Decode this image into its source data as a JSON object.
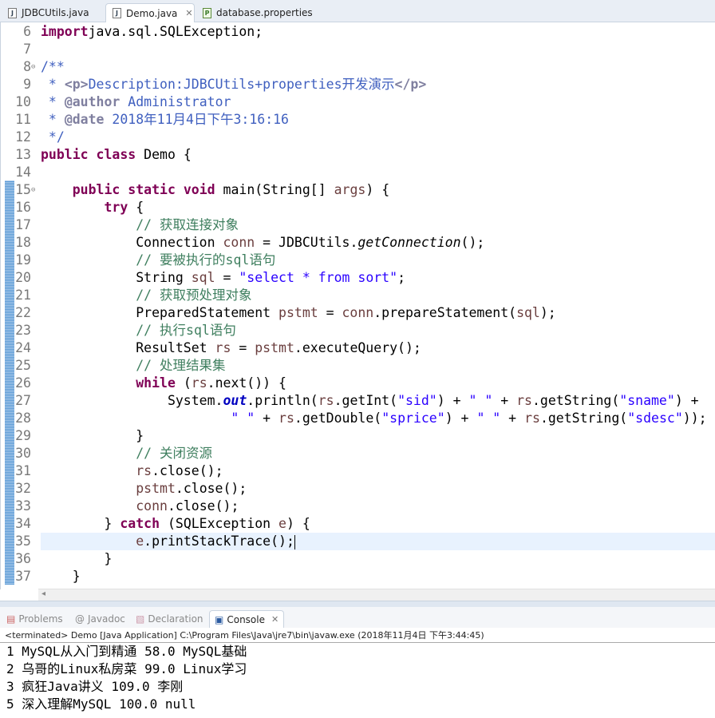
{
  "editor_tabs": [
    {
      "label": "JDBCUtils.java",
      "icon": "java-file-icon"
    },
    {
      "label": "Demo.java",
      "icon": "java-file-icon",
      "active": true,
      "close": "✕"
    },
    {
      "label": "database.properties",
      "icon": "properties-file-icon"
    }
  ],
  "code": {
    "first_line": 6,
    "current_line": 35,
    "folded_lines": [
      8,
      15
    ],
    "lines": [
      [
        [
          "kw",
          "import"
        ],
        [
          "",
          "java.sql.SQLException;"
        ]
      ],
      [],
      [
        [
          "jd",
          "/**"
        ]
      ],
      [
        [
          "jd",
          " * "
        ],
        [
          "tag",
          "<p>"
        ],
        [
          "jd",
          "Description:JDBCUtils+properties开发演示"
        ],
        [
          "tag",
          "</p>"
        ]
      ],
      [
        [
          "jd",
          " * "
        ],
        [
          "tag",
          "@author"
        ],
        [
          "jd",
          " Administrator"
        ]
      ],
      [
        [
          "jd",
          " * "
        ],
        [
          "tag",
          "@date"
        ],
        [
          "jd",
          " 2018年11月4日下午3:16:16"
        ]
      ],
      [
        [
          "jd",
          " */"
        ]
      ],
      [
        [
          "kw",
          "public"
        ],
        [
          "",
          " "
        ],
        [
          "kw",
          "class"
        ],
        [
          "",
          " Demo {"
        ]
      ],
      [],
      [
        [
          "",
          "    "
        ],
        [
          "kw",
          "public"
        ],
        [
          "",
          " "
        ],
        [
          "kw",
          "static"
        ],
        [
          "",
          " "
        ],
        [
          "kw",
          "void"
        ],
        [
          "",
          " main(String[] "
        ],
        [
          "var",
          "args"
        ],
        [
          "",
          ") {"
        ]
      ],
      [
        [
          "",
          "        "
        ],
        [
          "kw",
          "try"
        ],
        [
          "",
          " {"
        ]
      ],
      [
        [
          "",
          "            "
        ],
        [
          "cm",
          "// 获取连接对象"
        ]
      ],
      [
        [
          "",
          "            Connection "
        ],
        [
          "var",
          "conn"
        ],
        [
          "",
          " = JDBCUtils."
        ],
        [
          "smeth",
          "getConnection"
        ],
        [
          "",
          "();"
        ]
      ],
      [
        [
          "",
          "            "
        ],
        [
          "cm",
          "// 要被执行的sql语句"
        ]
      ],
      [
        [
          "",
          "            String "
        ],
        [
          "var",
          "sql"
        ],
        [
          "",
          " = "
        ],
        [
          "str",
          "\"select * from sort\""
        ],
        [
          "",
          ";"
        ]
      ],
      [
        [
          "",
          "            "
        ],
        [
          "cm",
          "// 获取预处理对象"
        ]
      ],
      [
        [
          "",
          "            PreparedStatement "
        ],
        [
          "var",
          "pstmt"
        ],
        [
          "",
          " = "
        ],
        [
          "var",
          "conn"
        ],
        [
          "",
          ".prepareStatement("
        ],
        [
          "var",
          "sql"
        ],
        [
          "",
          ");"
        ]
      ],
      [
        [
          "",
          "            "
        ],
        [
          "cm",
          "// 执行sql语句"
        ]
      ],
      [
        [
          "",
          "            ResultSet "
        ],
        [
          "var",
          "rs"
        ],
        [
          "",
          " = "
        ],
        [
          "var",
          "pstmt"
        ],
        [
          "",
          ".executeQuery();"
        ]
      ],
      [
        [
          "",
          "            "
        ],
        [
          "cm",
          "// 处理结果集"
        ]
      ],
      [
        [
          "",
          "            "
        ],
        [
          "kw",
          "while"
        ],
        [
          "",
          " ("
        ],
        [
          "var",
          "rs"
        ],
        [
          "",
          ".next()) {"
        ]
      ],
      [
        [
          "",
          "                System."
        ],
        [
          "sfld",
          "out"
        ],
        [
          "",
          ".println("
        ],
        [
          "var",
          "rs"
        ],
        [
          "",
          ".getInt("
        ],
        [
          "str",
          "\"sid\""
        ],
        [
          "",
          ") + "
        ],
        [
          "str",
          "\" \""
        ],
        [
          "",
          " + "
        ],
        [
          "var",
          "rs"
        ],
        [
          "",
          ".getString("
        ],
        [
          "str",
          "\"sname\""
        ],
        [
          "",
          ") +"
        ]
      ],
      [
        [
          "",
          "                        "
        ],
        [
          "str",
          "\" \""
        ],
        [
          "",
          " + "
        ],
        [
          "var",
          "rs"
        ],
        [
          "",
          ".getDouble("
        ],
        [
          "str",
          "\"sprice\""
        ],
        [
          "",
          ") + "
        ],
        [
          "str",
          "\" \""
        ],
        [
          "",
          " + "
        ],
        [
          "var",
          "rs"
        ],
        [
          "",
          ".getString("
        ],
        [
          "str",
          "\"sdesc\""
        ],
        [
          "",
          "));"
        ]
      ],
      [
        [
          "",
          "            }"
        ]
      ],
      [
        [
          "",
          "            "
        ],
        [
          "cm",
          "// 关闭资源"
        ]
      ],
      [
        [
          "",
          "            "
        ],
        [
          "var",
          "rs"
        ],
        [
          "",
          ".close();"
        ]
      ],
      [
        [
          "",
          "            "
        ],
        [
          "var",
          "pstmt"
        ],
        [
          "",
          ".close();"
        ]
      ],
      [
        [
          "",
          "            "
        ],
        [
          "var",
          "conn"
        ],
        [
          "",
          ".close();"
        ]
      ],
      [
        [
          "",
          "        } "
        ],
        [
          "kw",
          "catch"
        ],
        [
          "",
          " (SQLException "
        ],
        [
          "var",
          "e"
        ],
        [
          "",
          ") {"
        ]
      ],
      [
        [
          "",
          "            "
        ],
        [
          "var",
          "e"
        ],
        [
          "",
          ".printStackTrace();"
        ]
      ],
      [
        [
          "",
          "        }"
        ]
      ],
      [
        [
          "",
          "    }"
        ]
      ]
    ]
  },
  "bottom_tabs": [
    {
      "label": "Problems",
      "icon": "problems-icon"
    },
    {
      "label": "Javadoc",
      "icon": "at-icon"
    },
    {
      "label": "Declaration",
      "icon": "declaration-icon"
    },
    {
      "label": "Console",
      "icon": "console-icon",
      "active": true,
      "close": "✕"
    }
  ],
  "console": {
    "status": "<terminated> Demo [Java Application] C:\\Program Files\\Java\\jre7\\bin\\javaw.exe (2018年11月4日 下午3:44:45)",
    "output": [
      "1 MySQL从入门到精通 58.0 MySQL基础",
      "2 乌哥的Linux私房菜 99.0 Linux学习",
      "3 疯狂Java讲义 109.0 李刚",
      "5 深入理解MySQL 100.0 null"
    ]
  },
  "colors": {
    "keyword": "#7f0055",
    "comment": "#3f7f5f",
    "javadoc": "#3f5fbf",
    "string": "#2a00ff",
    "local_var": "#6a3e3e",
    "current_line": "#e8f2fe"
  }
}
